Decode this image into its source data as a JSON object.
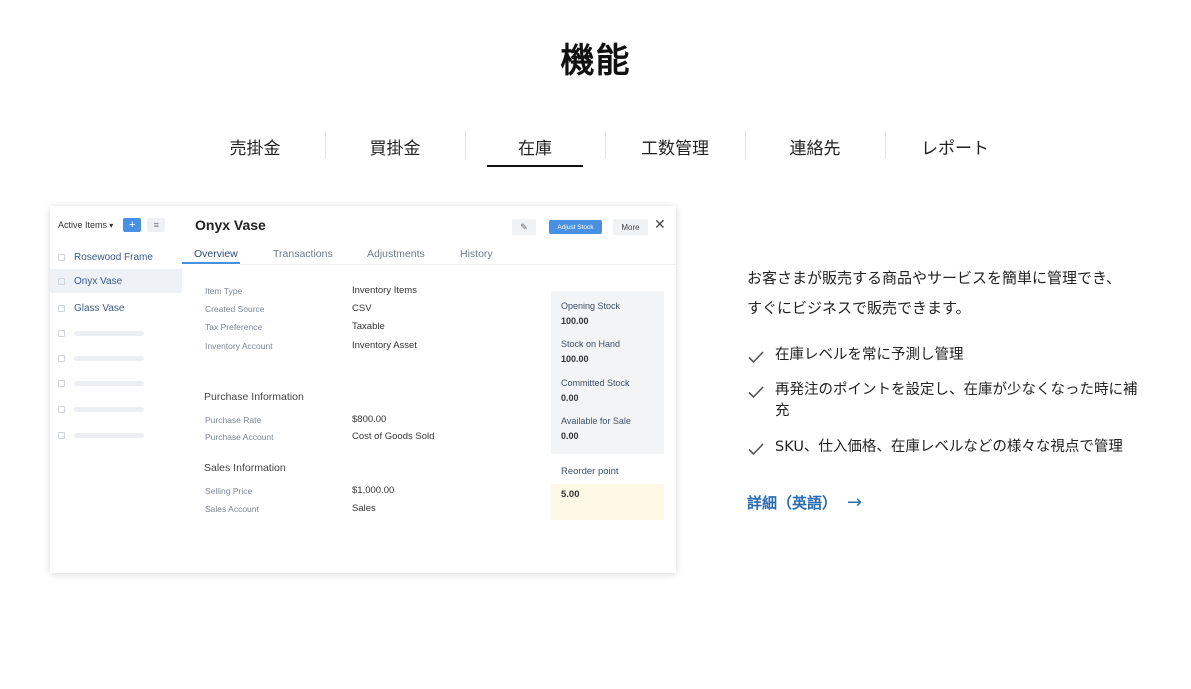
{
  "title": "機能",
  "tabs": [
    {
      "label": "売掛金"
    },
    {
      "label": "買掛金"
    },
    {
      "label": "在庫"
    },
    {
      "label": "工数管理"
    },
    {
      "label": "連絡先"
    },
    {
      "label": "レポート"
    }
  ],
  "active_tab": "在庫",
  "screenshot": {
    "sidebar": {
      "filter_label": "Active Items",
      "add_label": "+",
      "menu_label": "≡",
      "items": [
        {
          "label": "Rosewood Frame"
        },
        {
          "label": "Onyx Vase"
        },
        {
          "label": "Glass Vase"
        }
      ]
    },
    "item_name": "Onyx Vase",
    "actions": {
      "edit": "✎",
      "adjust_stock": "Adjust Stock",
      "more": "More",
      "close": "✕"
    },
    "tabs": [
      {
        "label": "Overview"
      },
      {
        "label": "Transactions"
      },
      {
        "label": "Adjustments"
      },
      {
        "label": "History"
      }
    ],
    "fields": [
      {
        "label": "Item Type",
        "value": "Inventory Items"
      },
      {
        "label": "Created Source",
        "value": "CSV"
      },
      {
        "label": "Tax Preference",
        "value": "Taxable"
      },
      {
        "label": "Inventory Account",
        "value": "Inventory Asset"
      }
    ],
    "purchase": {
      "title": "Purchase Information",
      "fields": [
        {
          "label": "Purchase Rate",
          "value": "$800.00"
        },
        {
          "label": "Purchase Account",
          "value": "Cost of Goods Sold"
        }
      ]
    },
    "sales": {
      "title": "Sales Information",
      "fields": [
        {
          "label": "Selling Price",
          "value": "$1,000.00"
        },
        {
          "label": "Sales Account",
          "value": "Sales"
        }
      ]
    },
    "stock": [
      {
        "label": "Opening Stock",
        "value": "100.00"
      },
      {
        "label": "Stock on Hand",
        "value": "100.00"
      },
      {
        "label": "Committed Stock",
        "value": "0.00"
      },
      {
        "label": "Available for Sale",
        "value": "0.00"
      }
    ],
    "reorder": {
      "label": "Reorder point",
      "value": "5.00"
    }
  },
  "description": "お客さまが販売する商品やサービスを簡単に管理でき、すぐにビジネスで販売できます。",
  "features": [
    {
      "text": "在庫レベルを常に予測し管理"
    },
    {
      "text": "再発注のポイントを設定し、在庫が少なくなった時に補充"
    },
    {
      "text": "SKU、仕入価格、在庫レベルなどの様々な視点で管理"
    }
  ],
  "more_link": "詳細（英語）",
  "more_arrow": "→",
  "colors": {
    "link": "#2b6cb0",
    "accent": "#4a90e2",
    "check": "#555555"
  }
}
